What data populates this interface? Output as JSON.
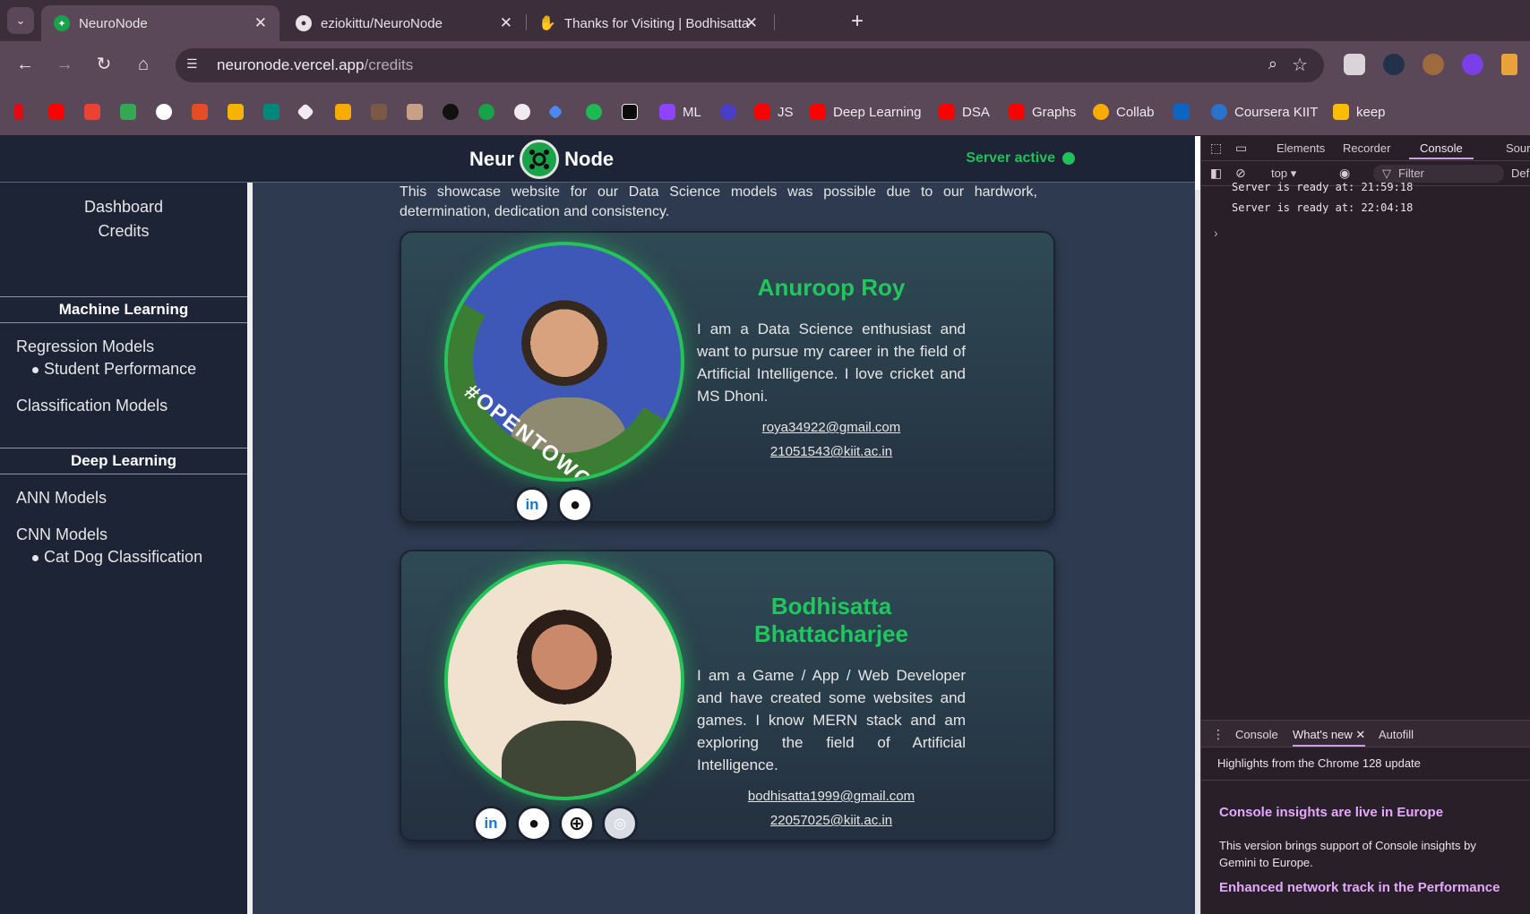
{
  "browser": {
    "tabs": [
      {
        "title": "NeuroNode",
        "favicon": "neuronode-icon",
        "active": true
      },
      {
        "title": "eziokittu/NeuroNode",
        "favicon": "github-icon",
        "active": false
      },
      {
        "title": "Thanks for Visiting | Bodhisatta",
        "favicon": "hand-icon",
        "active": false
      }
    ],
    "url_host": "neuronode.vercel.app",
    "url_path": "/credits",
    "bookmarks": [
      "ML",
      "JS",
      "Deep Learning",
      "DSA",
      "Graphs",
      "Collab",
      "Coursera KIIT",
      "keep"
    ]
  },
  "app": {
    "brand_left": "Neur",
    "brand_right": "Node",
    "server_status": "Server active",
    "status_color": "#20c05a",
    "accent_color": "#22c55e"
  },
  "sidebar": {
    "top_links": [
      "Dashboard",
      "Credits"
    ],
    "sections": [
      {
        "title": "Machine Learning",
        "groups": [
          {
            "label": "Regression Models",
            "items": [
              "Student Performance"
            ]
          },
          {
            "label": "Classification Models",
            "items": []
          }
        ]
      },
      {
        "title": "Deep Learning",
        "groups": [
          {
            "label": "ANN Models",
            "items": []
          },
          {
            "label": "CNN Models",
            "items": [
              "Cat Dog Classification"
            ]
          }
        ]
      }
    ]
  },
  "credits": {
    "intro": "This showcase website for our Data Science models was possible due to our hardwork, determination, dedication and consistency.",
    "people": [
      {
        "name": "Anuroop Roy",
        "bio": "I am a Data Science enthusiast and want to pursue my career in the field of Artificial Intelligence. I love cricket and MS Dhoni.",
        "emails": [
          "roya34922@gmail.com",
          "21051543@kiit.ac.in"
        ],
        "badge": "#OPENTOWORK",
        "socials": [
          "linkedin-icon",
          "github-icon"
        ]
      },
      {
        "name": "Bodhisatta Bhattacharjee",
        "bio": "I am a Game / App / Web Developer and have created some websites and games. I know MERN stack and am exploring the field of Artificial Intelligence.",
        "emails": [
          "bodhisatta1999@gmail.com",
          "22057025@kiit.ac.in"
        ],
        "socials": [
          "linkedin-icon",
          "github-icon",
          "globe-icon",
          "instagram-icon"
        ]
      }
    ]
  },
  "devtools": {
    "tabs": [
      "Elements",
      "Recorder",
      "Console",
      "Sour"
    ],
    "context": "top",
    "filter_placeholder": "Filter",
    "level": "Def",
    "logs": [
      "Server is ready at: 21:59:18",
      "Server is ready at: 22:04:18"
    ],
    "drawer_tabs": [
      "Console",
      "What's new",
      "Autofill"
    ],
    "drawer_heading": "Highlights from the Chrome 128 update",
    "news": [
      {
        "title": "Console insights are live in Europe",
        "body": "This version brings support of Console insights by Gemini to Europe."
      },
      {
        "title": "Enhanced network track in the Performance"
      }
    ]
  }
}
